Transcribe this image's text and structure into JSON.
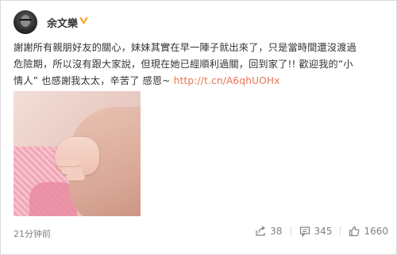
{
  "post": {
    "author": "余文樂",
    "verified_icon": "verified-badge-icon",
    "text_line_1": "謝謝所有親朋好友的關心，妹妹其實在早一陣子就出來了，只是當時間還沒渡過",
    "text_line_2": "危險期，所以沒有跟大家說，但現在她已經順利過關，回到家了!! 歡迎我的“小",
    "text_line_3": "情人” 也感謝我太太，辛苦了 感恩~ ",
    "link": "http://t.cn/A6qhUOHx",
    "time": "21分钟前",
    "photo_description_icon": "baby-hand-photo"
  },
  "actions": {
    "share_count": "38",
    "comment_count": "345",
    "like_count": "1660"
  },
  "colors": {
    "link": "#eb7350",
    "verified": "#f5a623",
    "muted": "#808080"
  }
}
